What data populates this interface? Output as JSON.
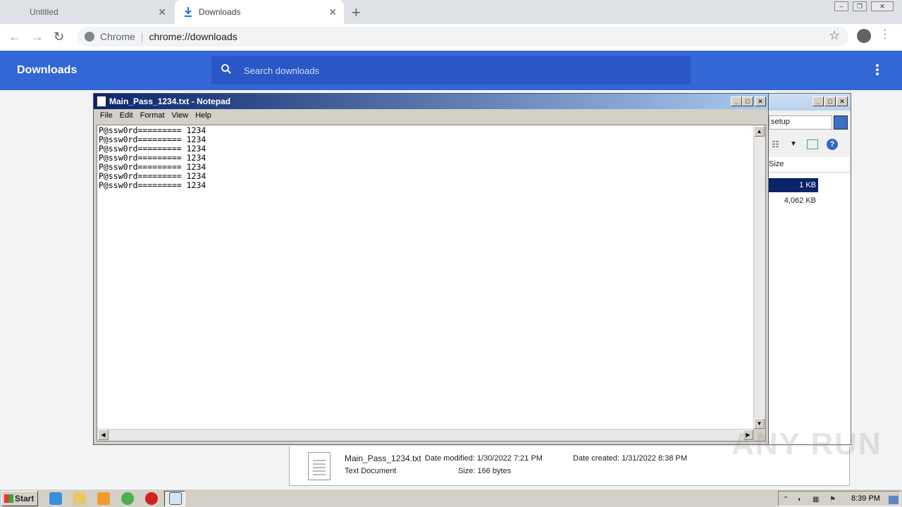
{
  "tabs": [
    {
      "label": "Untitled"
    },
    {
      "label": "Downloads"
    }
  ],
  "omnibox": {
    "scheme_label": "Chrome",
    "url": "chrome://downloads"
  },
  "downloads": {
    "title": "Downloads",
    "search_placeholder": "Search downloads"
  },
  "notepad": {
    "title": "Main_Pass_1234.txt - Notepad",
    "menu": [
      "File",
      "Edit",
      "Format",
      "View",
      "Help"
    ],
    "lines": [
      "P@ssw0rd========= 1234",
      "P@ssw0rd========= 1234",
      "P@ssw0rd========= 1234",
      "P@ssw0rd========= 1234",
      "P@ssw0rd========= 1234",
      "P@ssw0rd========= 1234",
      "P@ssw0rd========= 1234"
    ]
  },
  "explorer": {
    "search_value": "setup",
    "column_header": "Size",
    "rows": [
      {
        "size": "1 KB",
        "selected": true
      },
      {
        "size": "4,062 KB",
        "selected": false
      }
    ],
    "details": {
      "file_name": "Main_Pass_1234.txt",
      "type": "Text Document",
      "date_modified": "Date modified: 1/30/2022 7:21 PM",
      "size": "Size: 166 bytes",
      "date_created": "Date created: 1/31/2022 8:38 PM"
    }
  },
  "taskbar": {
    "start_label": "Start",
    "clock": "8:39 PM"
  },
  "watermark": "ANY RUN",
  "colors": {
    "downloads_header": "#3367d6",
    "notepad_title_start": "#0a246a",
    "selection": "#0a246a"
  }
}
